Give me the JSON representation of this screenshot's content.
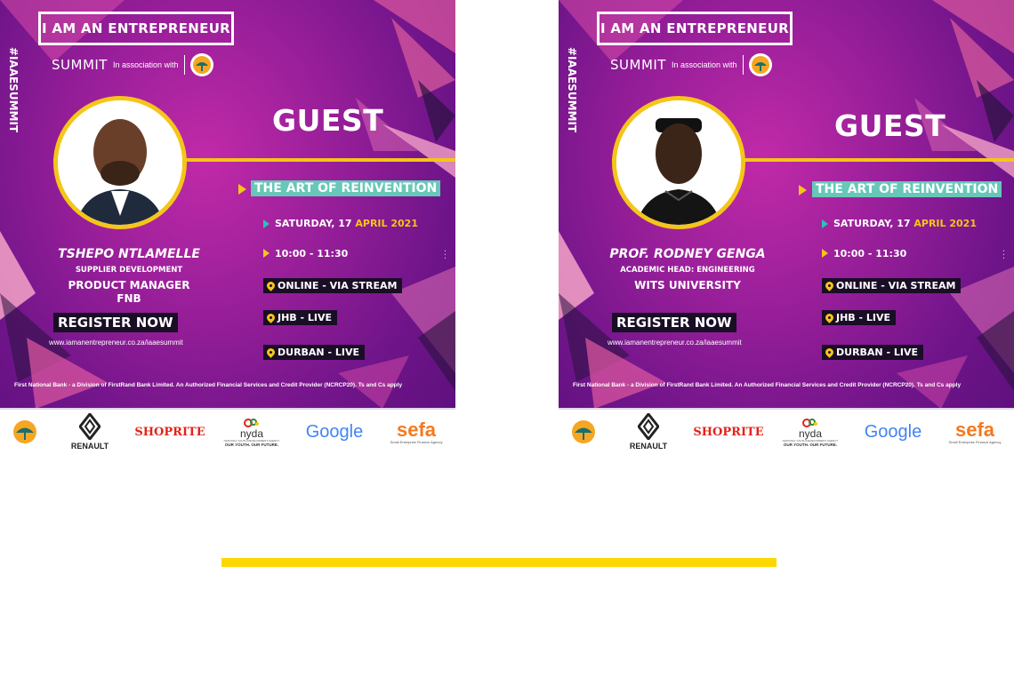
{
  "posters": [
    {
      "brand_title": "I AM AN ENTREPRENEUR",
      "summit_word": "SUMMIT",
      "association_text": "In association with",
      "hashtag": "#IAAESUMMIT",
      "heading": "GUEST",
      "topic": "THE ART OF REINVENTION",
      "date_prefix": "SATURDAY, 17 ",
      "date_highlight": "APRIL 2021",
      "time": "10:00 - 11:30",
      "locations": [
        "ONLINE - VIA STREAM",
        "JHB - LIVE",
        "DURBAN - LIVE"
      ],
      "guest_name": "TSHEPO NTLAMELLE",
      "role_line1": "SUPPLIER DEVELOPMENT",
      "role_line2": "PRODUCT MANAGER",
      "role_line3": "FNB",
      "register_label": "REGISTER NOW",
      "url": "www.iamanentrepreneur.co.za/iaaesummit",
      "legal": "First National Bank - a Division of FirstRand Bank Limited. An Authorized Financial Services and Credit Provider (NCRCP20). Ts and Cs apply",
      "sponsors": {
        "renault": "RENAULT",
        "shoprite": "SHOPRITE",
        "nyda": "nyda",
        "nyda_tagline": "OUR YOUTH. OUR FUTURE.",
        "nyda_small": "NATIONAL YOUTH DEVELOPMENT AGENCY",
        "google": "Google",
        "sefa": "sefa",
        "sefa_tagline": "Small Enterprise Finance Agency"
      }
    },
    {
      "brand_title": "I AM AN ENTREPRENEUR",
      "summit_word": "SUMMIT",
      "association_text": "In association with",
      "hashtag": "#IAAESUMMIT",
      "heading": "GUEST",
      "topic": "THE ART OF REINVENTION",
      "date_prefix": "SATURDAY, 17 ",
      "date_highlight": "APRIL 2021",
      "time": "10:00 - 11:30",
      "locations": [
        "ONLINE - VIA STREAM",
        "JHB - LIVE",
        "DURBAN - LIVE"
      ],
      "guest_name": "PROF. RODNEY GENGA",
      "role_line1": "ACADEMIC HEAD: ENGINEERING",
      "role_line2": "WITS UNIVERSITY",
      "register_label": "REGISTER NOW",
      "url": "www.iamanentrepreneur.co.za/iaaesummit",
      "legal": "First National Bank - a Division of FirstRand Bank Limited. An Authorized Financial Services and Credit Provider (NCRCP20). Ts and Cs apply",
      "sponsors": {
        "renault": "RENAULT",
        "shoprite": "SHOPRITE",
        "nyda": "nyda",
        "nyda_tagline": "OUR YOUTH. OUR FUTURE.",
        "nyda_small": "NATIONAL YOUTH DEVELOPMENT AGENCY",
        "google": "Google",
        "sefa": "sefa",
        "sefa_tagline": "Small Enterprise Finance Agency"
      }
    }
  ],
  "colors": {
    "purple": "#9a1f9a",
    "yellow": "#f5c518",
    "teal": "#67c7b8",
    "dark_label": "#1a0d26",
    "separator_bar": "#fcd700"
  }
}
